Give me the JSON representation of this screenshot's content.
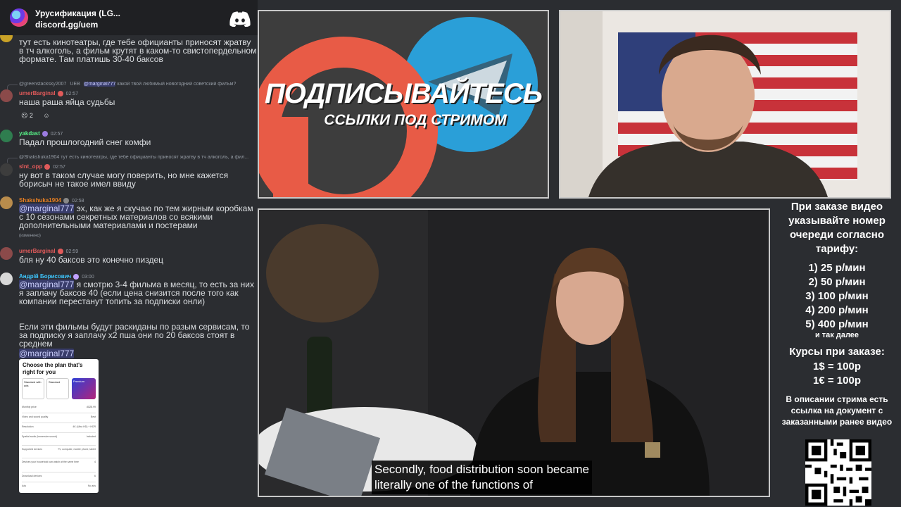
{
  "header": {
    "server_name": "Урусификация (LG...",
    "server_link": "discord.gg/uem"
  },
  "messages": [
    {
      "type": "continuation",
      "text": "тут есть кинотеатры, где тебе официанты приносят жратву в тч алкоголь, а фильм крутят в каком-то свистопердельном формате. Там платишь 30-40 баксов"
    },
    {
      "type": "message",
      "reply_author": "@greenstacksky2007",
      "reply_badge": "UEB",
      "reply_mention": "@marginal777",
      "reply_text": "какой твой любимый новогодний советский фильм?",
      "author": "umerBarginal",
      "time": "02:57",
      "text": "наша раша яйца судьбы",
      "reaction_count": "2"
    },
    {
      "type": "message",
      "author": "yakdast",
      "time": "02:57",
      "text": "Падал прошлогодний снег комфи"
    },
    {
      "type": "message",
      "reply_author": "@Shakshuka1904",
      "reply_text": "тут есть кинотеатры, где тебе официанты приносят жратву в тч алкоголь, а фил...",
      "author": "slnt_opp",
      "time": "02:57",
      "text": "ну вот в таком случае могу поверить, но мне кажется борисыч не такое имел ввиду"
    },
    {
      "type": "message",
      "author": "Shakshuka1904",
      "time": "02:58",
      "mention": "@marginal777",
      "text": "эх, как же я скучаю по тем жирным коробкам с 10 сезонами секретных материалов со всякими дополнительными материалами и постерами",
      "edited": "(изменено)"
    },
    {
      "type": "message",
      "author": "umerBarginal",
      "time": "02:59",
      "text": "бля ну 40 баксов это конечно пиздец"
    },
    {
      "type": "message",
      "author": "Андрій Борисович",
      "time": "03:00",
      "mention": "@marginal777",
      "text": "я смотрю 3-4 фильма в месяц, то есть за них я заплачу баксов 40 (если цена снизится после того как компании перестанут топить за подписки онли)"
    },
    {
      "type": "continuation",
      "text": "Если эти фильмы будут раскиданы по разым сервисам, то за подписку я заплачу x2 пша они по 20 баксов стоят в среднем",
      "mention": "@marginal777"
    }
  ],
  "plan_card": {
    "title": "Choose the plan that's right for you",
    "plans": [
      "Standard with ads",
      "Standard",
      "Premium"
    ],
    "rows": [
      {
        "k": "Monthly price",
        "v": "A$28.99"
      },
      {
        "k": "Video and sound quality",
        "v": "Best"
      },
      {
        "k": "Resolution",
        "v": "4K (Ultra HD) + HDR"
      },
      {
        "k": "Spatial audio (immersive sound)",
        "v": "Included"
      },
      {
        "k": "Supported devices",
        "v": "TV, computer, mobile phone, tablet"
      },
      {
        "k": "Devices your household can watch at the same time",
        "v": "4"
      },
      {
        "k": "Download devices",
        "v": "6"
      },
      {
        "k": "Ads",
        "v": "No ads"
      }
    ]
  },
  "promo": {
    "headline": "ПОДПИСЫВАЙТЕСЬ",
    "subline": "ССЫЛКИ ПОД СТРИМОМ",
    "colors": {
      "patreon": "#e85b46",
      "telegram": "#2a9fd8"
    }
  },
  "video": {
    "subtitle_line1": "Secondly, food distribution soon became",
    "subtitle_line2": "literally one of the functions of"
  },
  "info": {
    "order_note": "При заказе видео указывайте номер очереди согласно тарифу:",
    "tariffs": [
      "1) 25 р/мин",
      "2) 50 р/мин",
      "3) 100 р/мин",
      "4) 200 р/мин",
      "5) 400 р/мин"
    ],
    "etc": "и так далее",
    "rates_title": "Курсы при заказе:",
    "rates": [
      "1$ = 100р",
      "1€ = 100р"
    ],
    "description_note": "В описании стрима есть ссылка на документ с заказанными ранее видео"
  }
}
